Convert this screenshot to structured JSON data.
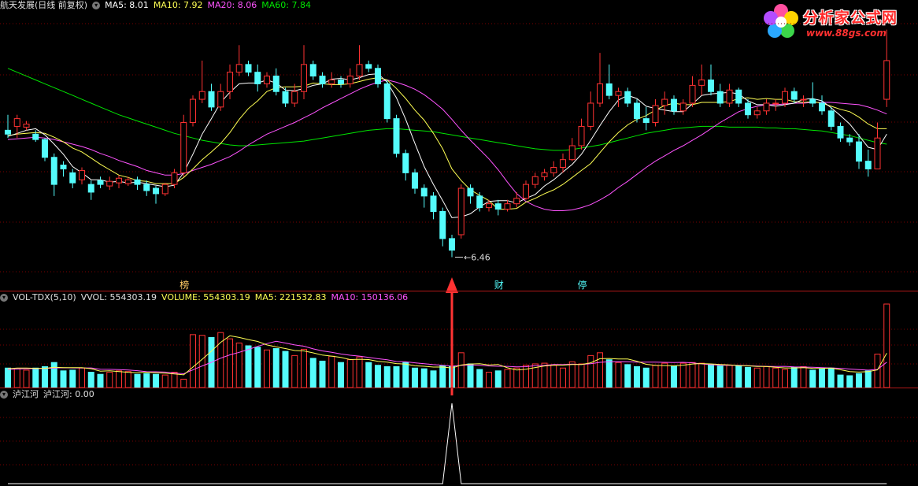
{
  "header": {
    "stock_name": "航天发展(日线 前复权)",
    "ma5": "MA5: 8.01",
    "ma10": "MA10: 7.92",
    "ma20": "MA20: 8.06",
    "ma60": "MA60: 7.84"
  },
  "logo": {
    "name": "分析家公式网",
    "url": "www.88gs.com"
  },
  "volume_header": {
    "indicator": "VOL-TDX(5,10)",
    "vvol": "VVOL: 554303.19",
    "volume": "VOLUME: 554303.19",
    "ma5": "MA5: 221532.83",
    "ma10": "MA10: 150136.06"
  },
  "indicator_header": {
    "name": "泸江河",
    "value": "泸江河: 0.00"
  },
  "colors": {
    "up": "#ff3232",
    "down": "#54fcfc",
    "ma5": "#ffffff",
    "ma10": "#ffff54",
    "ma20": "#ff54ff",
    "ma60": "#00e600",
    "divider": "#b01818",
    "gridline": "#7a0000",
    "signal_arrow": "#ff3333"
  },
  "chart_data": [
    {
      "type": "candlestick",
      "panel": "price",
      "y_unit": "price",
      "ylim": [
        6.2,
        9.6
      ],
      "x_count": 96,
      "low_marker": {
        "index": 48,
        "label": "6.46"
      },
      "event_tags": [
        {
          "index": 19,
          "label": "榜"
        },
        {
          "index": 53,
          "label": "财"
        },
        {
          "index": 62,
          "label": "停"
        }
      ],
      "open": [
        8.1,
        8.15,
        8.14,
        8.05,
        7.98,
        7.75,
        7.65,
        7.55,
        7.46,
        7.4,
        7.45,
        7.38,
        7.42,
        7.41,
        7.46,
        7.4,
        7.35,
        7.28,
        7.4,
        7.55,
        8.2,
        8.5,
        8.6,
        8.4,
        8.6,
        8.85,
        8.95,
        8.85,
        8.7,
        8.8,
        8.6,
        8.45,
        8.6,
        8.95,
        8.8,
        8.7,
        8.75,
        8.7,
        8.8,
        8.95,
        8.9,
        8.7,
        8.25,
        7.8,
        7.55,
        7.35,
        7.25,
        7.05,
        6.7,
        6.75,
        7.35,
        7.25,
        7.1,
        7.15,
        7.08,
        7.15,
        7.22,
        7.4,
        7.5,
        7.55,
        7.62,
        7.72,
        7.9,
        8.15,
        8.45,
        8.7,
        8.55,
        8.6,
        8.45,
        8.25,
        8.2,
        8.42,
        8.5,
        8.35,
        8.45,
        8.68,
        8.75,
        8.6,
        8.45,
        8.62,
        8.45,
        8.3,
        8.35,
        8.45,
        8.45,
        8.6,
        8.5,
        8.5,
        8.45,
        8.35,
        8.15,
        8.0,
        7.95,
        7.7,
        7.6,
        8.5
      ],
      "close": [
        8.05,
        8.25,
        8.18,
        7.98,
        7.75,
        7.4,
        7.6,
        7.42,
        7.58,
        7.3,
        7.4,
        7.44,
        7.48,
        7.46,
        7.4,
        7.32,
        7.28,
        7.4,
        7.55,
        8.2,
        8.5,
        8.6,
        8.4,
        8.6,
        8.85,
        8.95,
        8.85,
        8.7,
        8.8,
        8.6,
        8.45,
        8.6,
        8.95,
        8.8,
        8.7,
        8.75,
        8.7,
        8.8,
        8.95,
        8.9,
        8.7,
        8.25,
        7.8,
        7.55,
        7.35,
        7.25,
        7.05,
        6.7,
        6.55,
        7.35,
        7.25,
        7.1,
        7.15,
        7.08,
        7.15,
        7.22,
        7.4,
        7.5,
        7.55,
        7.62,
        7.72,
        7.9,
        8.15,
        8.45,
        8.7,
        8.55,
        8.6,
        8.45,
        8.25,
        8.2,
        8.42,
        8.5,
        8.35,
        8.45,
        8.68,
        8.75,
        8.6,
        8.45,
        8.62,
        8.45,
        8.3,
        8.35,
        8.45,
        8.45,
        8.6,
        8.5,
        8.5,
        8.45,
        8.35,
        8.15,
        8.0,
        7.95,
        7.7,
        7.6,
        8.0,
        9.0
      ],
      "high": [
        8.3,
        8.3,
        8.22,
        8.1,
        8.0,
        7.8,
        7.7,
        7.6,
        7.62,
        7.45,
        7.5,
        7.5,
        7.52,
        7.5,
        7.5,
        7.45,
        7.38,
        7.42,
        7.6,
        8.3,
        8.55,
        9.0,
        8.7,
        8.7,
        8.95,
        9.2,
        9.0,
        8.95,
        8.85,
        8.9,
        8.65,
        8.7,
        9.2,
        9.0,
        8.85,
        8.85,
        8.8,
        8.9,
        9.2,
        9.0,
        8.95,
        8.75,
        8.3,
        7.85,
        7.6,
        7.4,
        7.3,
        7.1,
        6.75,
        7.4,
        7.4,
        7.3,
        7.2,
        7.2,
        7.2,
        7.3,
        7.45,
        7.55,
        7.6,
        7.7,
        7.8,
        8.0,
        8.25,
        8.6,
        9.1,
        8.95,
        8.65,
        8.65,
        8.5,
        8.4,
        8.5,
        8.6,
        8.55,
        8.5,
        8.8,
        8.95,
        8.95,
        8.7,
        8.7,
        8.65,
        8.5,
        8.4,
        8.5,
        8.5,
        8.65,
        8.65,
        8.55,
        8.72,
        8.55,
        8.4,
        8.2,
        8.05,
        8.05,
        7.85,
        8.2,
        9.4
      ],
      "low": [
        8.0,
        8.0,
        8.1,
        7.95,
        7.7,
        7.25,
        7.5,
        7.35,
        7.4,
        7.2,
        7.35,
        7.33,
        7.35,
        7.38,
        7.33,
        7.25,
        7.15,
        7.25,
        7.35,
        7.5,
        8.15,
        8.45,
        8.35,
        8.35,
        8.5,
        8.8,
        8.8,
        8.6,
        8.65,
        8.55,
        8.4,
        8.4,
        8.5,
        8.75,
        8.65,
        8.65,
        8.65,
        8.65,
        8.75,
        8.85,
        8.65,
        8.2,
        7.75,
        7.45,
        7.28,
        7.1,
        6.95,
        6.6,
        6.46,
        6.7,
        7.15,
        7.05,
        7.05,
        7.0,
        7.05,
        7.1,
        7.2,
        7.35,
        7.45,
        7.5,
        7.55,
        7.7,
        7.85,
        8.1,
        8.4,
        8.5,
        8.4,
        8.4,
        8.2,
        8.1,
        8.15,
        8.3,
        8.3,
        8.3,
        8.4,
        8.55,
        8.55,
        8.4,
        8.4,
        8.4,
        8.25,
        8.25,
        8.3,
        8.35,
        8.4,
        8.45,
        8.4,
        8.4,
        8.3,
        8.1,
        7.95,
        7.9,
        7.6,
        7.5,
        7.6,
        8.4
      ],
      "ma5": [
        8.02,
        8.06,
        8.1,
        8.12,
        8.04,
        7.92,
        7.79,
        7.63,
        7.55,
        7.46,
        7.46,
        7.43,
        7.44,
        7.42,
        7.43,
        7.41,
        7.39,
        7.37,
        7.39,
        7.55,
        7.79,
        8.05,
        8.25,
        8.46,
        8.59,
        8.7,
        8.71,
        8.71,
        8.75,
        8.71,
        8.62,
        8.61,
        8.64,
        8.68,
        8.7,
        8.76,
        8.77,
        8.75,
        8.78,
        8.82,
        8.83,
        8.72,
        8.52,
        8.24,
        7.93,
        7.63,
        7.4,
        7.19,
        6.97,
        6.98,
        7.02,
        7.11,
        7.18,
        7.19,
        7.19,
        7.16,
        7.22,
        7.27,
        7.38,
        7.46,
        7.56,
        7.66,
        7.79,
        7.97,
        8.16,
        8.34,
        8.49,
        8.55,
        8.51,
        8.41,
        8.38,
        8.36,
        8.34,
        8.34,
        8.44,
        8.55,
        8.57,
        8.58,
        8.59,
        8.57,
        8.48,
        8.43,
        8.43,
        8.41,
        8.43,
        8.45,
        8.5,
        8.51,
        8.48,
        8.39,
        8.29,
        8.18,
        8.03,
        7.88,
        7.85,
        8.05
      ],
      "ma10": [
        8.03,
        8.05,
        8.06,
        8.07,
        8.06,
        8.01,
        7.95,
        7.87,
        7.82,
        7.74,
        7.66,
        7.59,
        7.52,
        7.49,
        7.45,
        7.44,
        7.41,
        7.41,
        7.41,
        7.49,
        7.6,
        7.72,
        7.82,
        7.93,
        8.07,
        8.24,
        8.38,
        8.48,
        8.6,
        8.65,
        8.66,
        8.66,
        8.67,
        8.71,
        8.7,
        8.69,
        8.69,
        8.7,
        8.73,
        8.76,
        8.78,
        8.75,
        8.64,
        8.51,
        8.36,
        8.23,
        8.06,
        7.86,
        7.6,
        7.45,
        7.33,
        7.26,
        7.19,
        7.08,
        7.08,
        7.09,
        7.17,
        7.22,
        7.28,
        7.33,
        7.4,
        7.49,
        7.58,
        7.67,
        7.81,
        7.95,
        8.07,
        8.17,
        8.24,
        8.29,
        8.36,
        8.42,
        8.45,
        8.43,
        8.43,
        8.46,
        8.46,
        8.46,
        8.47,
        8.51,
        8.52,
        8.5,
        8.51,
        8.5,
        8.5,
        8.47,
        8.46,
        8.47,
        8.45,
        8.41,
        8.37,
        8.34,
        8.27,
        8.18,
        8.12,
        8.12
      ],
      "ma20": [
        7.98,
        7.99,
        8.0,
        8.01,
        8.0,
        7.98,
        7.95,
        7.92,
        7.89,
        7.85,
        7.8,
        7.76,
        7.71,
        7.67,
        7.63,
        7.58,
        7.55,
        7.52,
        7.52,
        7.54,
        7.58,
        7.62,
        7.66,
        7.71,
        7.76,
        7.83,
        7.91,
        7.98,
        8.05,
        8.1,
        8.15,
        8.2,
        8.26,
        8.32,
        8.39,
        8.45,
        8.51,
        8.57,
        8.63,
        8.68,
        8.72,
        8.75,
        8.72,
        8.68,
        8.63,
        8.56,
        8.47,
        8.37,
        8.24,
        8.1,
        7.97,
        7.85,
        7.73,
        7.59,
        7.43,
        7.28,
        7.18,
        7.12,
        7.08,
        7.06,
        7.06,
        7.07,
        7.1,
        7.14,
        7.2,
        7.27,
        7.36,
        7.44,
        7.53,
        7.62,
        7.7,
        7.77,
        7.84,
        7.9,
        7.97,
        8.04,
        8.12,
        8.2,
        8.27,
        8.34,
        8.38,
        8.41,
        8.43,
        8.43,
        8.44,
        8.45,
        8.45,
        8.46,
        8.46,
        8.46,
        8.45,
        8.44,
        8.43,
        8.4,
        8.36,
        8.31
      ],
      "ma60": [
        8.9,
        8.85,
        8.8,
        8.75,
        8.7,
        8.65,
        8.6,
        8.55,
        8.5,
        8.45,
        8.4,
        8.35,
        8.3,
        8.26,
        8.22,
        8.18,
        8.14,
        8.1,
        8.06,
        8.03,
        8.0,
        7.97,
        7.95,
        7.93,
        7.91,
        7.9,
        7.9,
        7.91,
        7.92,
        7.93,
        7.94,
        7.95,
        7.96,
        7.98,
        8.0,
        8.02,
        8.04,
        8.06,
        8.08,
        8.1,
        8.11,
        8.12,
        8.12,
        8.11,
        8.1,
        8.09,
        8.08,
        8.06,
        8.04,
        8.02,
        8.0,
        7.98,
        7.96,
        7.94,
        7.92,
        7.9,
        7.88,
        7.86,
        7.85,
        7.84,
        7.84,
        7.85,
        7.87,
        7.89,
        7.91,
        7.94,
        7.97,
        8.0,
        8.03,
        8.06,
        8.08,
        8.1,
        8.12,
        8.13,
        8.14,
        8.15,
        8.15,
        8.15,
        8.14,
        8.14,
        8.14,
        8.14,
        8.13,
        8.13,
        8.12,
        8.12,
        8.11,
        8.1,
        8.09,
        8.07,
        8.05,
        8.03,
        8.0,
        7.97,
        7.94,
        7.92
      ]
    },
    {
      "type": "bar",
      "panel": "volume",
      "y_unit": "volume",
      "ylim": [
        0,
        600000
      ],
      "values": [
        140000,
        135000,
        125000,
        140000,
        150000,
        180000,
        120000,
        125000,
        140000,
        110000,
        95000,
        110000,
        120000,
        115000,
        95000,
        100000,
        95000,
        90000,
        110000,
        60000,
        380000,
        375000,
        360000,
        395000,
        350000,
        320000,
        300000,
        290000,
        270000,
        280000,
        260000,
        230000,
        275000,
        210000,
        190000,
        225000,
        180000,
        200000,
        220000,
        180000,
        160000,
        150000,
        150000,
        180000,
        140000,
        135000,
        120000,
        155000,
        150000,
        250000,
        170000,
        130000,
        110000,
        120000,
        130000,
        140000,
        160000,
        170000,
        175000,
        160000,
        140000,
        185000,
        170000,
        230000,
        250000,
        200000,
        180000,
        165000,
        150000,
        140000,
        160000,
        175000,
        155000,
        175000,
        180000,
        175000,
        165000,
        155000,
        160000,
        155000,
        145000,
        140000,
        150000,
        140000,
        130000,
        145000,
        150000,
        125000,
        135000,
        140000,
        90000,
        85000,
        100000,
        120000,
        240000,
        600000
      ],
      "ma5": [
        135000,
        140000,
        140000,
        138000,
        138000,
        146000,
        143000,
        143000,
        143000,
        135000,
        118000,
        120000,
        115000,
        110000,
        107000,
        110000,
        107000,
        103000,
        98000,
        91000,
        147000,
        203000,
        261000,
        325000,
        372000,
        360000,
        345000,
        331000,
        306000,
        292000,
        280000,
        266000,
        263000,
        249000,
        233000,
        226000,
        216000,
        201000,
        203000,
        201000,
        188000,
        182000,
        172000,
        168000,
        156000,
        153000,
        147000,
        148000,
        140000,
        162000,
        169000,
        171000,
        162000,
        166000,
        142000,
        126000,
        132000,
        144000,
        155000,
        161000,
        161000,
        166000,
        166000,
        178000,
        207000,
        209000,
        205000,
        205000,
        189000,
        167000,
        159000,
        158000,
        156000,
        161000,
        169000,
        172000,
        170000,
        166000,
        163000,
        158000,
        156000,
        151000,
        151000,
        146000,
        141000,
        141000,
        143000,
        138000,
        137000,
        140000,
        128000,
        115000,
        111000,
        115000,
        127000,
        247000
      ],
      "ma10": [
        130000,
        133000,
        135000,
        136000,
        137000,
        140000,
        142000,
        141000,
        141000,
        141000,
        132000,
        131000,
        129000,
        126000,
        121000,
        114000,
        113000,
        111000,
        104000,
        99000,
        127000,
        155000,
        181000,
        211000,
        235000,
        253000,
        274000,
        296000,
        316000,
        332000,
        320000,
        306000,
        297000,
        278000,
        263000,
        253000,
        241000,
        232000,
        226000,
        217000,
        207000,
        199000,
        187000,
        185000,
        178000,
        171000,
        165000,
        160000,
        154000,
        159000,
        163000,
        160000,
        155000,
        153000,
        152000,
        149000,
        150000,
        157000,
        159000,
        166000,
        165000,
        168000,
        166000,
        171000,
        181000,
        185000,
        186000,
        185000,
        183000,
        183000,
        183000,
        181000,
        180000,
        181000,
        178000,
        170000,
        164000,
        161000,
        160000,
        160000,
        157000,
        154000,
        152000,
        151000,
        152000,
        149000,
        147000,
        146000,
        143000,
        141000,
        138000,
        133000,
        129000,
        125000,
        130000,
        182000
      ]
    },
    {
      "type": "line",
      "panel": "indicator",
      "y_unit": "indicator value",
      "ylim": [
        0,
        1
      ],
      "spike_index": 48,
      "spike_value": 1,
      "baseline": 0
    }
  ]
}
